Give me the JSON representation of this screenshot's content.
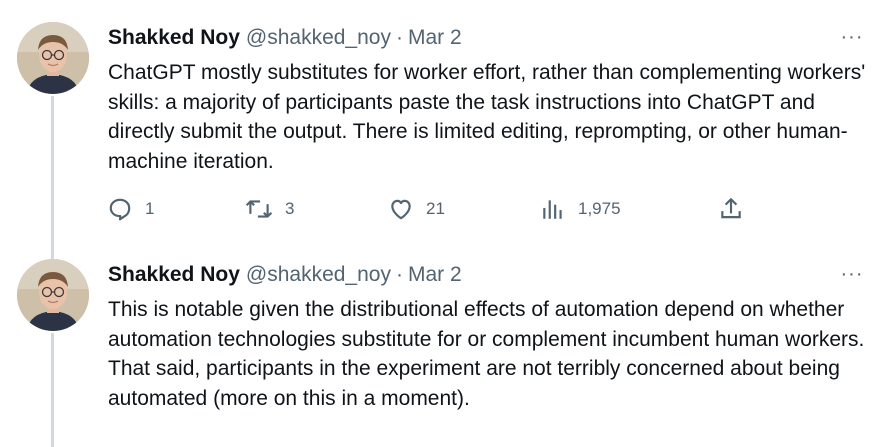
{
  "tweets": [
    {
      "author_name": "Shakked Noy",
      "author_handle": "@shakked_noy",
      "separator": "·",
      "date": "Mar 2",
      "text": "ChatGPT mostly substitutes for worker effort, rather than complementing workers' skills: a majority of participants paste the task instructions into ChatGPT and directly submit the output. There is limited editing, reprompting, or other human-machine iteration.",
      "more_label": "···",
      "actions": {
        "replies": "1",
        "retweets": "3",
        "likes": "21",
        "views": "1,975"
      }
    },
    {
      "author_name": "Shakked Noy",
      "author_handle": "@shakked_noy",
      "separator": "·",
      "date": "Mar 2",
      "text": "This is notable given the distributional effects of automation depend on whether automation technologies substitute for or complement incumbent human workers. That said, participants in the experiment are not terribly concerned about being automated (more on this in a moment).",
      "more_label": "···"
    }
  ],
  "icons": {
    "reply": "reply-icon",
    "retweet": "retweet-icon",
    "like": "heart-icon",
    "views": "analytics-icon",
    "share": "share-icon"
  },
  "colors": {
    "text": "#0f1419",
    "secondary": "#536471",
    "thread_line": "#cfd9de"
  }
}
